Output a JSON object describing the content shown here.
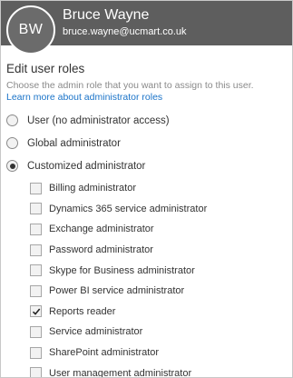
{
  "user": {
    "initials": "BW",
    "name": "Bruce Wayne",
    "email": "bruce.wayne@ucmart.co.uk"
  },
  "section": {
    "title": "Edit user roles",
    "description": "Choose the admin role that you want to assign to this user.",
    "learn_more": "Learn more about administrator roles"
  },
  "roles": [
    {
      "label": "User (no administrator access)",
      "selected": false
    },
    {
      "label": "Global administrator",
      "selected": false
    },
    {
      "label": "Customized administrator",
      "selected": true
    }
  ],
  "custom_roles": [
    {
      "label": "Billing administrator",
      "checked": false
    },
    {
      "label": "Dynamics 365 service administrator",
      "checked": false
    },
    {
      "label": "Exchange administrator",
      "checked": false
    },
    {
      "label": "Password administrator",
      "checked": false
    },
    {
      "label": "Skype for Business administrator",
      "checked": false
    },
    {
      "label": "Power BI service administrator",
      "checked": false
    },
    {
      "label": "Reports reader",
      "checked": true
    },
    {
      "label": "Service administrator",
      "checked": false
    },
    {
      "label": "SharePoint administrator",
      "checked": false
    },
    {
      "label": "User management administrator",
      "checked": false
    }
  ],
  "colors": {
    "header_bg": "#5e5e5e",
    "link": "#1a73c8"
  }
}
